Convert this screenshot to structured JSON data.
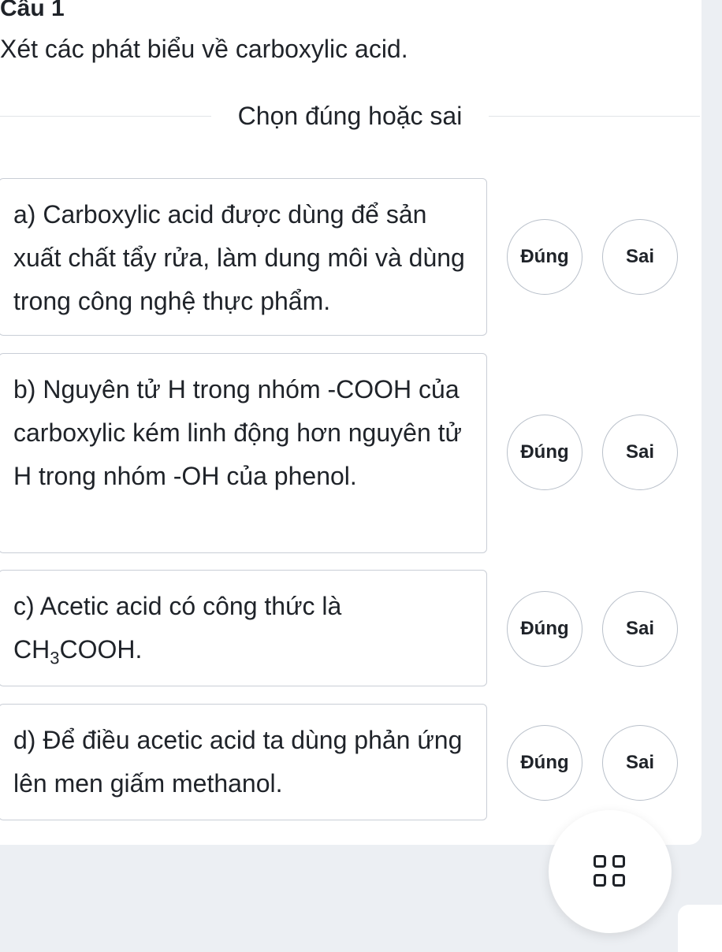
{
  "question": {
    "title": "Câu 1",
    "prompt": "Xét các phát biểu về carboxylic acid.",
    "instruction": "Chọn đúng hoặc sai"
  },
  "statements": [
    {
      "label": "a) Carboxylic acid được dùng để sản xuất chất tẩy rửa, làm dung môi và dùng trong công nghệ thực phẩm.",
      "true_label": "Đúng",
      "false_label": "Sai"
    },
    {
      "label": "b) Nguyên tử H trong nhóm -COOH của carboxylic kém linh động hơn nguyên tử H trong nhóm -OH của phenol.",
      "true_label": "Đúng",
      "false_label": "Sai"
    },
    {
      "label_prefix": "c) Acetic acid có công thức là CH",
      "label_sub": "3",
      "label_suffix": "COOH.",
      "true_label": "Đúng",
      "false_label": "Sai"
    },
    {
      "label": "d) Để điều acetic acid ta dùng phản ứng lên men giấm methanol.",
      "true_label": "Đúng",
      "false_label": "Sai"
    }
  ],
  "fab": {
    "icon": "grid-icon"
  },
  "colors": {
    "background": "#eceff3",
    "card": "#ffffff",
    "text": "#1f2329",
    "border": "#c9ced6"
  }
}
